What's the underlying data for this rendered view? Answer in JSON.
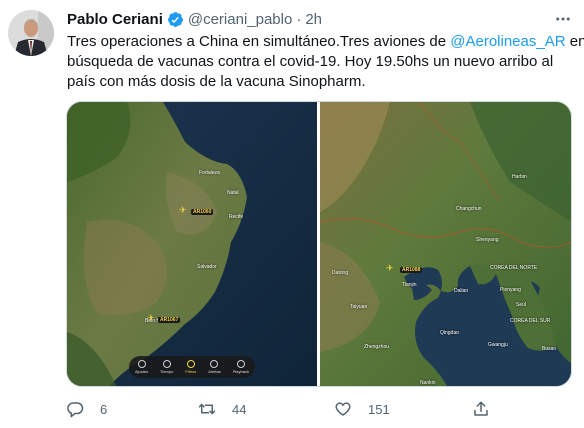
{
  "author": {
    "name": "Pablo Ceriani",
    "handle": "@ceriani_pablo",
    "separator": "·",
    "time": "2h"
  },
  "tweet": {
    "line1_pre": "Tres operaciones a China en simultáneo.Tres aviones de ",
    "mention": "@Aerolineas_AR",
    "line1_post": " en",
    "line2": "búsqueda de vacunas contra el covid-19. Hoy 19.50hs un nuevo arribo al",
    "line3": "país con más dosis de la vacuna Sinopharm."
  },
  "media": {
    "left_map": {
      "labels": [
        "Fortaleza",
        "Natal",
        "Recife",
        "Salvador",
        "Belo Horizonte"
      ],
      "flights": [
        "AR1060",
        "AR1067"
      ],
      "toolbar": [
        "Ajustes",
        "Tiempo",
        "Filtros",
        "Alertas",
        "Playback"
      ]
    },
    "right_map": {
      "labels": [
        "Harbin",
        "Changchun",
        "Shenyang",
        "COREA DEL NORTE",
        "Pionyang",
        "Datong",
        "Tianjin",
        "Dalian",
        "Seúl",
        "COREA DEL SUR",
        "Taiyuan",
        "Qingdao",
        "Gwangju",
        "Busan",
        "Zhengzhou",
        "Nankin"
      ],
      "flight": "AR1088"
    }
  },
  "stats": {
    "replies": "6",
    "retweets": "44",
    "likes": "151"
  },
  "colors": {
    "accent": "#1d9bf0",
    "muted": "#536471",
    "text": "#0f1419"
  },
  "icons": [
    "verified-badge-icon",
    "more-icon",
    "reply-icon",
    "retweet-icon",
    "like-icon",
    "share-icon",
    "plane-icon"
  ]
}
